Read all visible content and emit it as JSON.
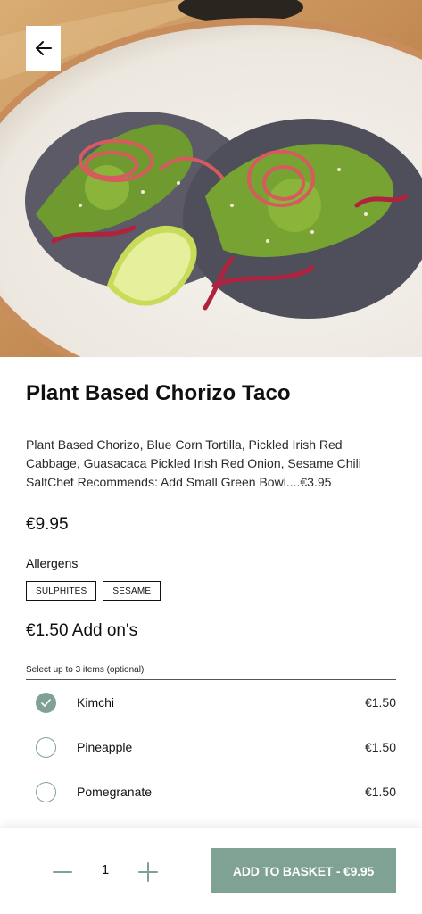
{
  "product": {
    "title": "Plant Based Chorizo Taco",
    "description": "Plant Based Chorizo, Blue Corn Tortilla, Pickled Irish Red Cabbage, Guasacaca Pickled Irish Red Onion, Sesame Chili SaltChef Recommends: Add Small Green Bowl....€3.95",
    "price": "€9.95",
    "image_icon": "food-photo"
  },
  "allergens": {
    "label": "Allergens",
    "tags": [
      "SULPHITES",
      "SESAME"
    ]
  },
  "addons": {
    "heading": "€1.50 Add on's",
    "hint": "Select up to 3 items (optional)",
    "items": [
      {
        "name": "Kimchi",
        "price": "€1.50",
        "checked": true
      },
      {
        "name": "Pineapple",
        "price": "€1.50",
        "checked": false
      },
      {
        "name": "Pomegranate",
        "price": "€1.50",
        "checked": false
      }
    ]
  },
  "footer": {
    "quantity": "1",
    "add_label": "ADD TO BASKET - €9.95"
  },
  "icons": {
    "back": "arrow-left-icon",
    "minus": "minus-icon",
    "plus": "plus-icon",
    "check": "check-icon"
  },
  "colors": {
    "accent": "#7fa294",
    "text": "#111111"
  }
}
